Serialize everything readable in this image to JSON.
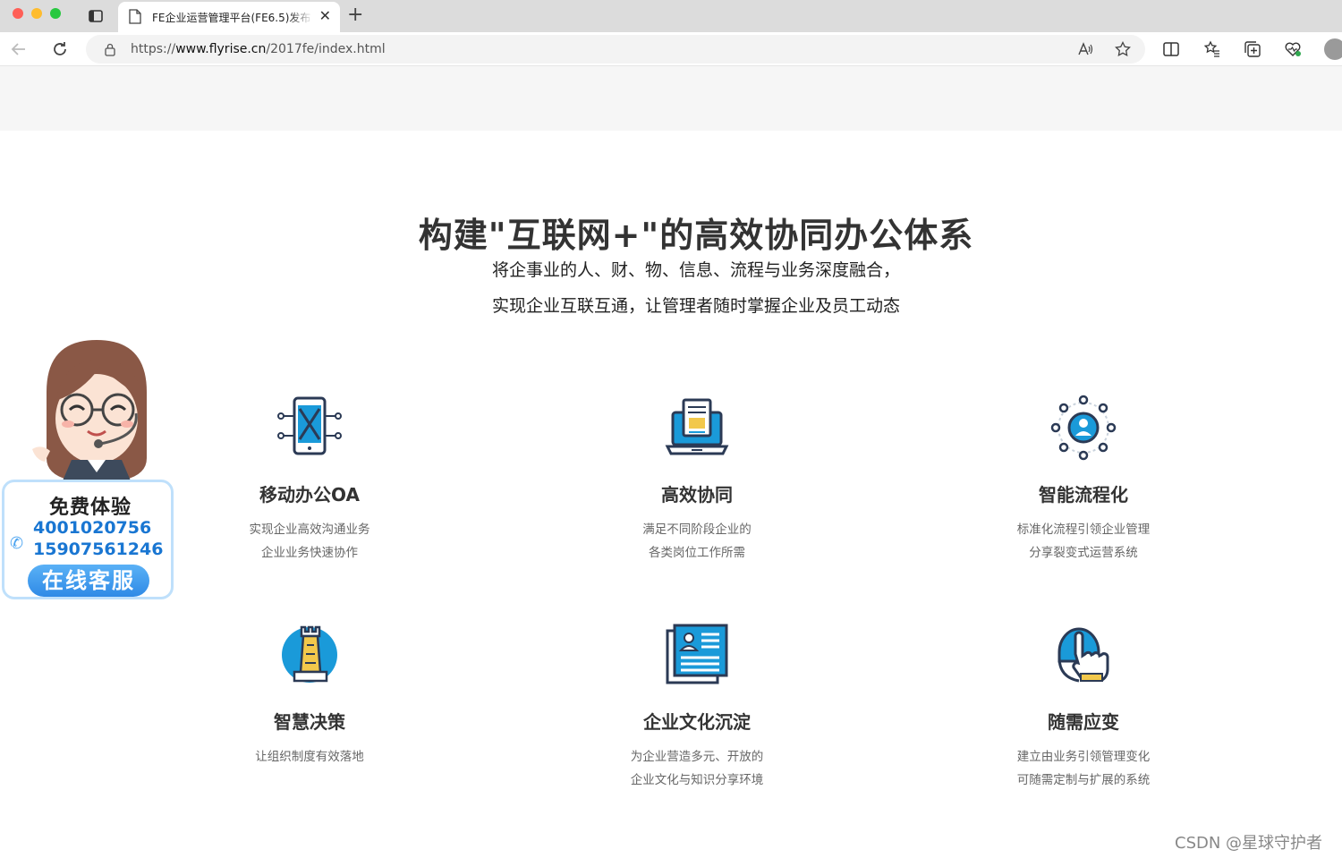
{
  "browser": {
    "tab_title": "FE企业运营管理平台(FE6.5)发布",
    "url_prefix": "https://",
    "url_host": "www.flyrise.cn",
    "url_path": "/2017fe/index.html"
  },
  "hero": {
    "title": "构建\"互联网+\"的高效协同办公体系",
    "subtitle_line1": "将企事业的人、财、物、信息、流程与业务深度融合，",
    "subtitle_line2": "实现企业互联互通，让管理者随时掌握企业及员工动态"
  },
  "features": [
    {
      "name": "移动办公OA",
      "desc1": "实现企业高效沟通业务",
      "desc2": "企业业务快速协作",
      "icon": "mobile-office-icon"
    },
    {
      "name": "高效协同",
      "desc1": "满足不同阶段企业的",
      "desc2": "各类岗位工作所需",
      "icon": "laptop-document-icon"
    },
    {
      "name": "智能流程化",
      "desc1": "标准化流程引领企业管理",
      "desc2": "分享裂变式运营系统",
      "icon": "network-hub-icon"
    },
    {
      "name": "智慧决策",
      "desc1": "让组织制度有效落地",
      "desc2": "",
      "icon": "chess-rook-icon"
    },
    {
      "name": "企业文化沉淀",
      "desc1": "为企业营造多元、开放的",
      "desc2": "企业文化与知识分享环境",
      "icon": "id-card-icon"
    },
    {
      "name": "随需应变",
      "desc1": "建立由业务引领管理变化",
      "desc2": "可随需定制与扩展的系统",
      "icon": "hand-pointer-icon"
    }
  ],
  "customer_service": {
    "free_trial": "免费体验",
    "phone1": "4001020756",
    "phone2": "15907561246",
    "online_label": "在线客服"
  },
  "watermark": "CSDN @星球守护者",
  "colors": {
    "accent_blue": "#1a9ad9",
    "dark_navy": "#2b3a55",
    "gold": "#f2c84b"
  }
}
